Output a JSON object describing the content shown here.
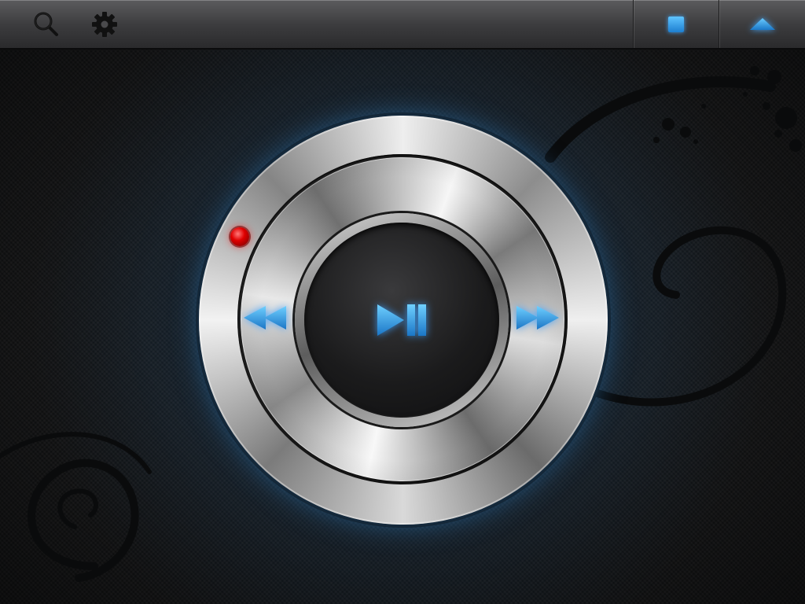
{
  "toolbar": {
    "left_icons": [
      "search-icon",
      "gear-icon"
    ],
    "right_buttons": [
      "stop-icon",
      "eject-icon"
    ]
  },
  "player": {
    "controls": [
      "rewind-icon",
      "play-pause-icon",
      "fast-forward-icon"
    ],
    "status_led": "red"
  },
  "colors": {
    "accent_blue": "#2b8fe0",
    "glow_blue": "#46aaff",
    "led_red": "#e00000",
    "toolbar_top": "#5c5c5e",
    "background": "#151617"
  }
}
